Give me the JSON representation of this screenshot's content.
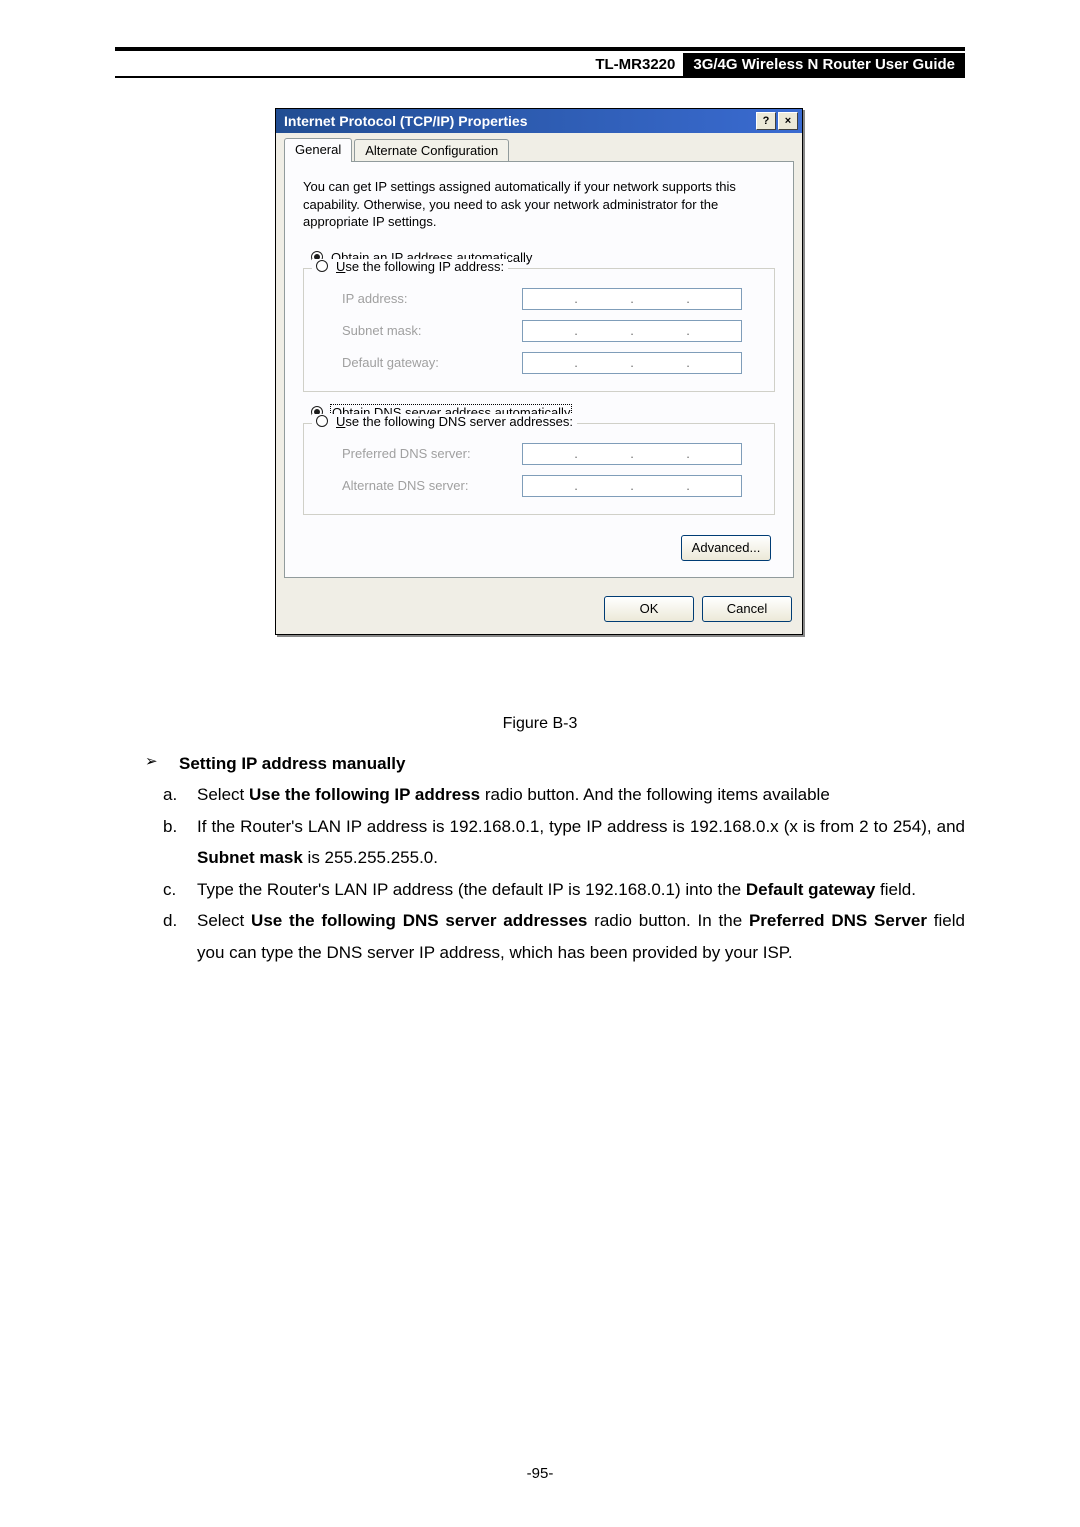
{
  "header": {
    "model": "TL-MR3220",
    "title": "3G/4G Wireless N Router User Guide"
  },
  "dialog": {
    "title": "Internet Protocol (TCP/IP) Properties",
    "help_btn": "?",
    "close_btn": "×",
    "tabs": {
      "general": "General",
      "alt": "Alternate Configuration"
    },
    "description": "You can get IP settings assigned automatically if your network supports this capability. Otherwise, you need to ask your network administrator for the appropriate IP settings.",
    "radio_ip_auto_pre": "O",
    "radio_ip_auto_label": "btain an IP address automatically",
    "radio_ip_manual_pre": "U",
    "radio_ip_manual_label": "se the following IP address:",
    "label_ip": "IP address:",
    "label_subnet": "Subnet mask:",
    "label_gateway": "Default gateway:",
    "radio_dns_auto_pre": "O",
    "radio_dns_auto_label": "btain DNS server address automatically",
    "radio_dns_manual_pre": "U",
    "radio_dns_manual_label": "se the following DNS server addresses:",
    "label_pref_dns": "Preferred DNS server:",
    "label_alt_dns": "Alternate DNS server:",
    "btn_advanced": "Advanced...",
    "btn_ok": "OK",
    "btn_cancel": "Cancel"
  },
  "figure_caption": "Figure B-3",
  "content": {
    "heading": "Setting IP address manually",
    "a_pre": "Select ",
    "a_bold": "Use the following IP address",
    "a_post": " radio button. And the following items available",
    "b_pre": "If the Router's LAN IP address is 192.168.0.1, type IP address is 192.168.0.x (x is from 2 to 254), and ",
    "b_bold": "Subnet mask",
    "b_post": " is 255.255.255.0.",
    "c_pre": "Type the Router's LAN IP address (the default IP is 192.168.0.1) into the ",
    "c_bold": "Default gateway",
    "c_post": " field.",
    "d_pre": "Select ",
    "d_bold1": "Use the following DNS server addresses",
    "d_mid": " radio button. In the ",
    "d_bold2": "Preferred DNS Server",
    "d_post": " field you can type the DNS server IP address, which has been provided by your ISP."
  },
  "footer": "-95-"
}
